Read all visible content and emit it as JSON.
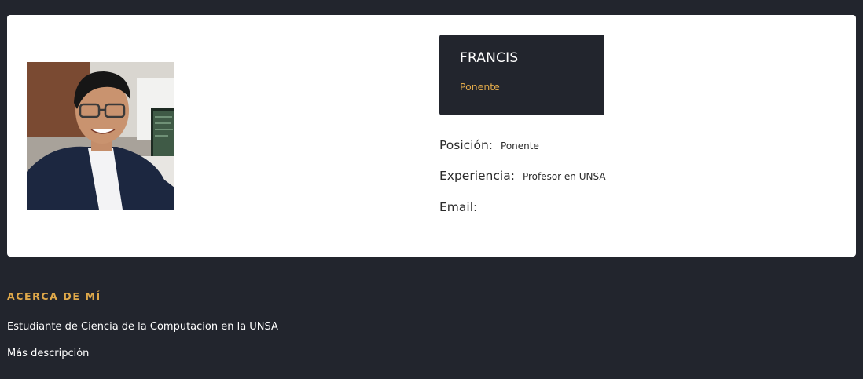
{
  "profile": {
    "name": "FRANCIS",
    "role": "Ponente",
    "photo_alt": "avatar",
    "details": [
      {
        "label": "Posición:",
        "value": "Ponente"
      },
      {
        "label": "Experiencia:",
        "value": "Profesor en UNSA"
      },
      {
        "label": "Email:",
        "value": ""
      }
    ]
  },
  "about": {
    "title": "ACERCA DE MÍ",
    "lines": [
      "Estudiante de Ciencia de la Computacion en la UNSA",
      "Más descripción"
    ]
  },
  "colors": {
    "background": "#22252d",
    "card": "#ffffff",
    "accent": "#e0a94a"
  }
}
